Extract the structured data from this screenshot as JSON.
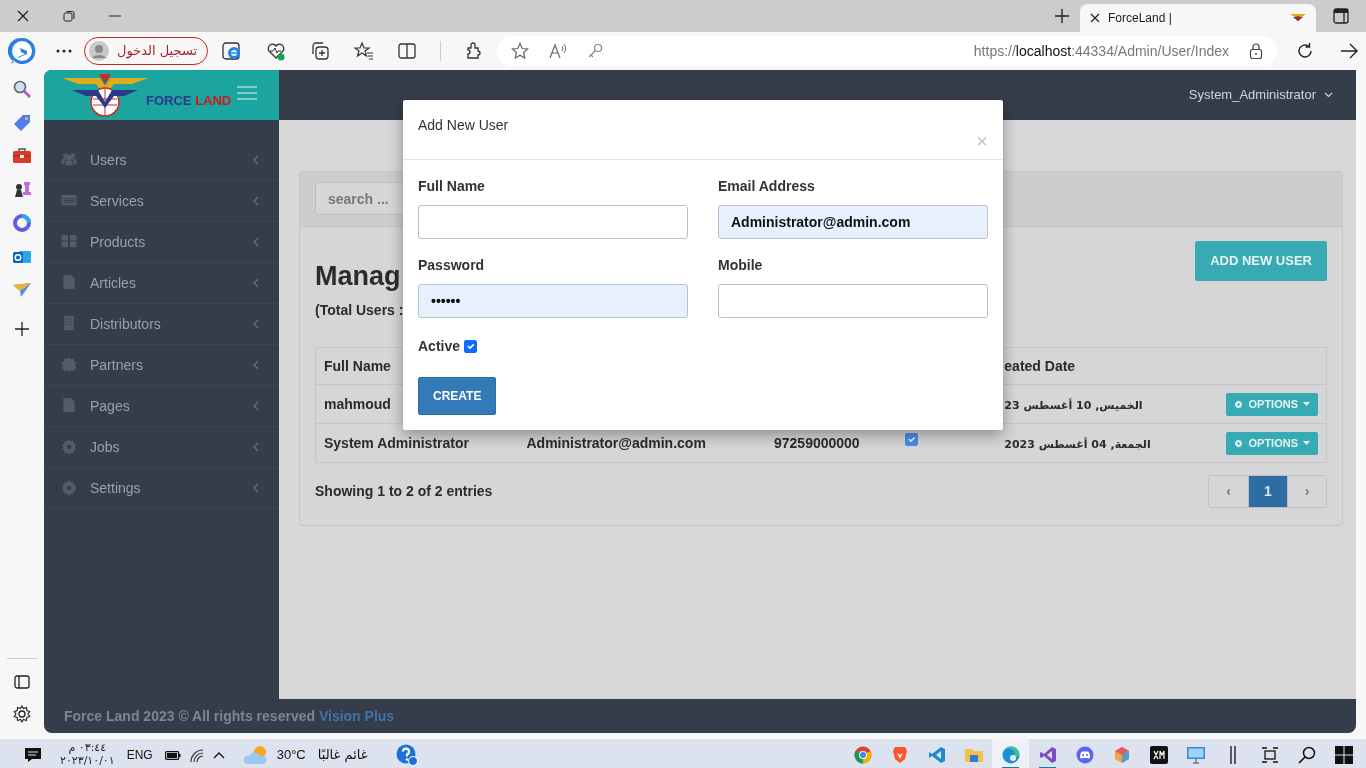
{
  "browser": {
    "tab": {
      "title": "ForceLand |",
      "selected": true
    },
    "profile_button": "تسجيل الدخول",
    "url": {
      "scheme": "https://",
      "host": "localhost",
      "path": ":44334/Admin/User/Index"
    }
  },
  "app": {
    "logo": {
      "part_1": "FORCE",
      "part_2": "LAND"
    },
    "user_menu": "System_Administrator",
    "sidebar": {
      "items": [
        {
          "label": "Users",
          "kind": "users"
        },
        {
          "label": "Services",
          "kind": "list"
        },
        {
          "label": "Products",
          "kind": "grid"
        },
        {
          "label": "Articles",
          "kind": "file"
        },
        {
          "label": "Distributors",
          "kind": "building"
        },
        {
          "label": "Partners",
          "kind": "badge"
        },
        {
          "label": "Pages",
          "kind": "file"
        },
        {
          "label": "Jobs",
          "kind": "gear"
        },
        {
          "label": "Settings",
          "kind": "gear"
        }
      ]
    }
  },
  "page": {
    "search": {
      "placeholder": "search ..."
    },
    "title": "Manag",
    "subtitle": "(Total Users :",
    "add_button": "ADD NEW USER",
    "table": {
      "columns": {
        "column_1": "Full Name",
        "column_5": "eated Date"
      },
      "rows": [
        {
          "column_1": "mahmoud",
          "column_5": "الخميس, 10 أغسطس 23",
          "options": "OPTIONS"
        },
        {
          "column_1": "System Administrator",
          "column_2": "Administrator@admin.com",
          "column_3": "97259000000",
          "active": true,
          "column_5": "الجمعة, 04 أغسطس 2023",
          "options": "OPTIONS"
        }
      ]
    },
    "summary": "Showing 1 to 2 of 2 entries",
    "pagination": [
      {
        "label": "‹",
        "selected": false
      },
      {
        "label": "1",
        "selected": true
      },
      {
        "label": "›",
        "selected": false
      }
    ]
  },
  "modal": {
    "title": "Add New User",
    "close": "×",
    "fields": [
      {
        "label": "Full Name",
        "autofilled": false
      },
      {
        "label": "Email Address",
        "value": "Administrator@admin.com",
        "autofilled": true
      },
      {
        "label": "Password",
        "value": "••••••",
        "autofilled": true
      },
      {
        "label": "Mobile",
        "autofilled": false
      }
    ],
    "active": {
      "label": "Active",
      "checked": true
    },
    "submit": "CREATE"
  },
  "footer": {
    "text": "Force Land 2023 © All rights reserved ",
    "link": "Vision Plus"
  },
  "taskbar": {
    "time": "٠٣:٤٤ م",
    "date": "٢٠٢٣/١٠/٠١",
    "language": "ENG",
    "temperature": "30°C",
    "weather": "غائم غالبًا",
    "apps": [
      {
        "selected": false,
        "running": false
      },
      {
        "selected": false,
        "running": false
      },
      {
        "selected": false,
        "running": false
      },
      {
        "selected": false,
        "running": false
      },
      {
        "selected": true,
        "running": true
      },
      {
        "selected": false,
        "running": true
      },
      {
        "selected": false,
        "running": false
      },
      {
        "selected": false,
        "running": false
      },
      {
        "selected": false,
        "running": false
      },
      {
        "selected": false,
        "running": false
      }
    ]
  }
}
